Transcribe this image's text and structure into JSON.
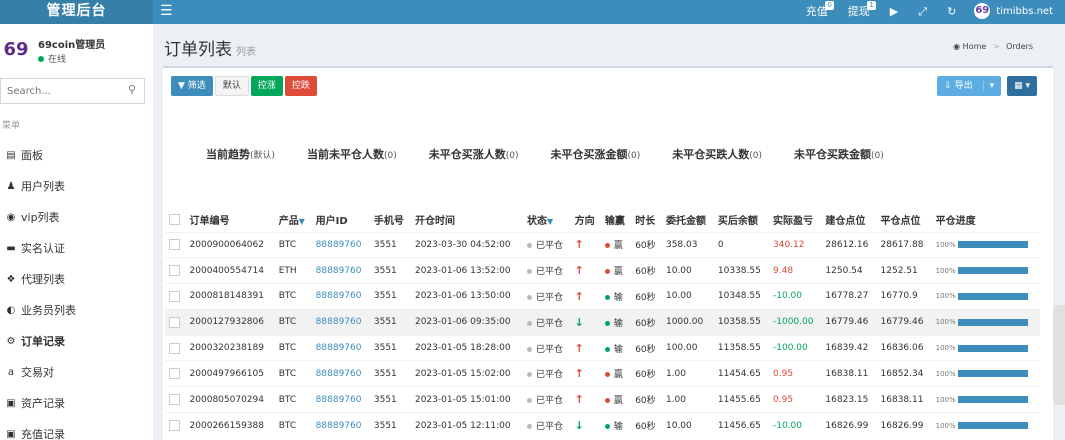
{
  "brand": {
    "title": "管理后台"
  },
  "topnav": {
    "recharge": "充值",
    "recharge_badge": "0",
    "withdraw": "提现",
    "withdraw_badge": "1",
    "user_logo_text": "69",
    "user_name": "timibbs.net"
  },
  "sidebar": {
    "avatar_text": "69",
    "admin_name": "69coin管理员",
    "status": "在线",
    "search_placeholder": "Search...",
    "menu_header": "菜单",
    "items": [
      {
        "label": "面板",
        "icon": "chart-area-icon"
      },
      {
        "label": "用户列表",
        "icon": "user-icon"
      },
      {
        "label": "vip列表",
        "icon": "vip-icon"
      },
      {
        "label": "实名认证",
        "icon": "id-card-icon"
      },
      {
        "label": "代理列表",
        "icon": "agent-icon"
      },
      {
        "label": "业务员列表",
        "icon": "adjust-icon"
      },
      {
        "label": "订单记录",
        "icon": "gear-icon"
      },
      {
        "label": "交易对",
        "icon": "amazon-icon"
      },
      {
        "label": "资产记录",
        "icon": "asset-icon"
      },
      {
        "label": "充值记录",
        "icon": "recharge-icon"
      }
    ]
  },
  "header": {
    "title": "订单列表",
    "subtitle": "列表",
    "breadcrumb_home": "Home",
    "breadcrumb_current": "Orders"
  },
  "toolbar": {
    "filter": "筛选",
    "default": "默认",
    "control_up": "控涨",
    "control_down": "控跌",
    "export": "导出"
  },
  "stats": [
    {
      "label": "当前趋势",
      "count": "(默认)"
    },
    {
      "label": "当前未平仓人数",
      "count": "(0)"
    },
    {
      "label": "未平仓买涨人数",
      "count": "(0)"
    },
    {
      "label": "未平仓买涨金额",
      "count": "(0)"
    },
    {
      "label": "未平仓买跌人数",
      "count": "(0)"
    },
    {
      "label": "未平仓买跌金额",
      "count": "(0)"
    }
  ],
  "table": {
    "headers": [
      "订单编号",
      "产品",
      "用户ID",
      "手机号",
      "开仓时间",
      "状态",
      "方向",
      "输赢",
      "时长",
      "委托金额",
      "买后余额",
      "实际盈亏",
      "建仓点位",
      "平仓点位",
      "平仓进度"
    ],
    "rows": [
      {
        "id": "2000900064062",
        "product": "BTC",
        "uid": "88889760",
        "phone": "3551",
        "time": "2023-03-30 04:52:00",
        "status": "已平仓",
        "dir": "up",
        "result": "赢",
        "result_type": "win",
        "duration": "60秒",
        "amount": "358.03",
        "balance": "0",
        "pnl": "340.12",
        "open": "28612.16",
        "close": "28617.88",
        "progress": "100%"
      },
      {
        "id": "2000400554714",
        "product": "ETH",
        "uid": "88889760",
        "phone": "3551",
        "time": "2023-01-06 13:52:00",
        "status": "已平仓",
        "dir": "up",
        "result": "赢",
        "result_type": "win",
        "duration": "60秒",
        "amount": "10.00",
        "balance": "10338.55",
        "pnl": "9.48",
        "open": "1250.54",
        "close": "1252.51",
        "progress": "100%"
      },
      {
        "id": "2000818148391",
        "product": "BTC",
        "uid": "88889760",
        "phone": "3551",
        "time": "2023-01-06 13:50:00",
        "status": "已平仓",
        "dir": "up",
        "result": "输",
        "result_type": "lose",
        "duration": "60秒",
        "amount": "10.00",
        "balance": "10348.55",
        "pnl": "-10.00",
        "open": "16778.27",
        "close": "16770.9",
        "progress": "100%"
      },
      {
        "id": "2000127932806",
        "product": "BTC",
        "uid": "88889760",
        "phone": "3551",
        "time": "2023-01-06 09:35:00",
        "status": "已平仓",
        "dir": "down",
        "result": "输",
        "result_type": "lose",
        "duration": "60秒",
        "amount": "1000.00",
        "balance": "10358.55",
        "pnl": "-1000.00",
        "open": "16779.46",
        "close": "16779.46",
        "progress": "100%"
      },
      {
        "id": "2000320238189",
        "product": "BTC",
        "uid": "88889760",
        "phone": "3551",
        "time": "2023-01-05 18:28:00",
        "status": "已平仓",
        "dir": "up",
        "result": "输",
        "result_type": "lose",
        "duration": "60秒",
        "amount": "100.00",
        "balance": "11358.55",
        "pnl": "-100.00",
        "open": "16839.42",
        "close": "16836.06",
        "progress": "100%"
      },
      {
        "id": "2000497966105",
        "product": "BTC",
        "uid": "88889760",
        "phone": "3551",
        "time": "2023-01-05 15:02:00",
        "status": "已平仓",
        "dir": "up",
        "result": "赢",
        "result_type": "win",
        "duration": "60秒",
        "amount": "1.00",
        "balance": "11454.65",
        "pnl": "0.95",
        "open": "16838.11",
        "close": "16852.34",
        "progress": "100%"
      },
      {
        "id": "2000805070294",
        "product": "BTC",
        "uid": "88889760",
        "phone": "3551",
        "time": "2023-01-05 15:01:00",
        "status": "已平仓",
        "dir": "up",
        "result": "赢",
        "result_type": "win",
        "duration": "60秒",
        "amount": "1.00",
        "balance": "11455.65",
        "pnl": "0.95",
        "open": "16823.15",
        "close": "16838.11",
        "progress": "100%"
      },
      {
        "id": "2000266159388",
        "product": "BTC",
        "uid": "88889760",
        "phone": "3551",
        "time": "2023-01-05 12:11:00",
        "status": "已平仓",
        "dir": "down",
        "result": "输",
        "result_type": "lose",
        "duration": "60秒",
        "amount": "10.00",
        "balance": "11456.65",
        "pnl": "-10.00",
        "open": "16826.99",
        "close": "16826.99",
        "progress": "100%"
      }
    ]
  }
}
